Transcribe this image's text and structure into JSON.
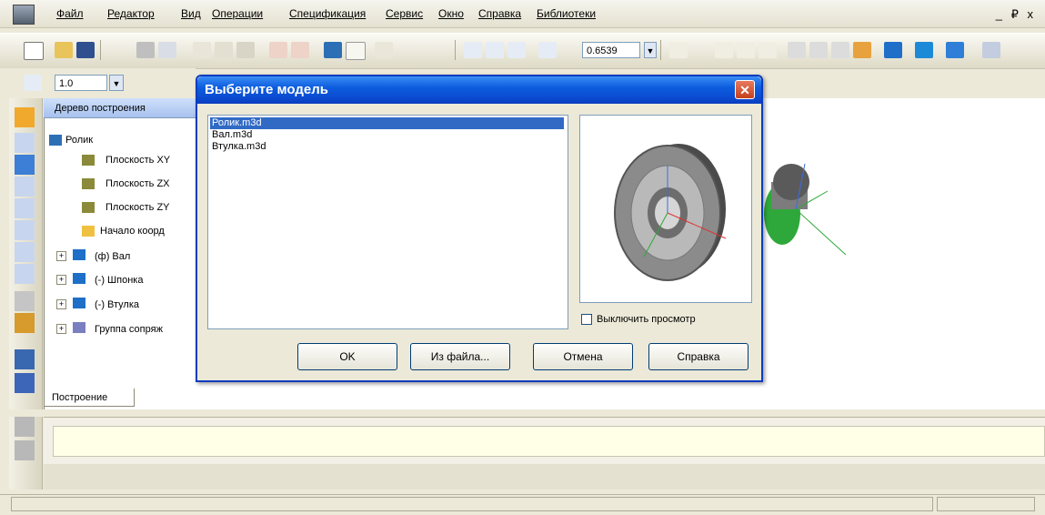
{
  "menu": {
    "items": [
      "Файл",
      "Редактор",
      "Вид",
      "Операции",
      "Спецификация",
      "Сервис",
      "Окно",
      "Справка",
      "Библиотеки"
    ],
    "window_controls": "_ ₽ x"
  },
  "toolbar": {
    "zoom_value": "0.6539",
    "scale_value": "1.0"
  },
  "tree": {
    "title": "Дерево построения",
    "root": "Ролик",
    "items": [
      {
        "label": "Плоскость XY",
        "icon": "plane-icon"
      },
      {
        "label": "Плоскость ZX",
        "icon": "plane-icon"
      },
      {
        "label": "Плоскость ZY",
        "icon": "plane-icon"
      },
      {
        "label": "Начало коорд",
        "icon": "origin-icon"
      },
      {
        "label": "(ф) Вал",
        "icon": "part-icon"
      },
      {
        "label": "(-) Шпонка",
        "icon": "part-icon"
      },
      {
        "label": "(-) Втулка",
        "icon": "part-icon"
      },
      {
        "label": "Группа сопряж",
        "icon": "mates-icon"
      }
    ],
    "tab_label": "Построение",
    "tab_arrows": "◁ ▷"
  },
  "dialog": {
    "title": "Выберите модель",
    "close_glyph": "✕",
    "models": [
      "Ролик.m3d",
      "Вал.m3d",
      "Втулка.m3d"
    ],
    "selected_index": 0,
    "disable_preview_label": "Выключить просмотр",
    "disable_preview_checked": false,
    "buttons": {
      "ok": "OK",
      "from_file": "Из файла...",
      "cancel": "Отмена",
      "help": "Справка"
    }
  },
  "colors": {
    "title_bar": "#0a4ad0",
    "selection": "#316ac5",
    "close": "#c5401b"
  }
}
